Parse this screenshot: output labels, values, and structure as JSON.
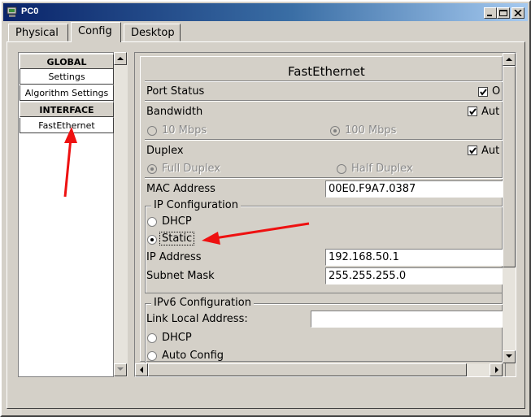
{
  "window": {
    "title": "PC0"
  },
  "tabs": [
    {
      "label": "Physical"
    },
    {
      "label": "Config"
    },
    {
      "label": "Desktop"
    }
  ],
  "sidebar": {
    "global_header": "GLOBAL",
    "settings": "Settings",
    "algorithm_settings": "Algorithm Settings",
    "interface_header": "INTERFACE",
    "fastethernet": "FastEthernet"
  },
  "panel": {
    "title": "FastEthernet",
    "port_status_label": "Port Status",
    "port_status_check": "O",
    "bandwidth_label": "Bandwidth",
    "bandwidth_auto": "Aut",
    "bw_10": "10 Mbps",
    "bw_100": "100 Mbps",
    "duplex_label": "Duplex",
    "duplex_auto": "Aut",
    "full_duplex": "Full Duplex",
    "half_duplex": "Half Duplex",
    "mac_label": "MAC Address",
    "mac_value": "00E0.F9A7.0387",
    "ip_config_title": "IP Configuration",
    "dhcp": "DHCP",
    "static": "Static",
    "ip_label": "IP Address",
    "ip_value": "192.168.50.1",
    "mask_label": "Subnet Mask",
    "mask_value": "255.255.255.0",
    "ipv6_title": "IPv6 Configuration",
    "link_local_label": "Link Local Address:",
    "link_local_value": "",
    "ipv6_dhcp": "DHCP",
    "ipv6_auto": "Auto Config"
  },
  "colors": {
    "annotation_arrow": "#ee1111",
    "titlebar": "#0a246a"
  }
}
